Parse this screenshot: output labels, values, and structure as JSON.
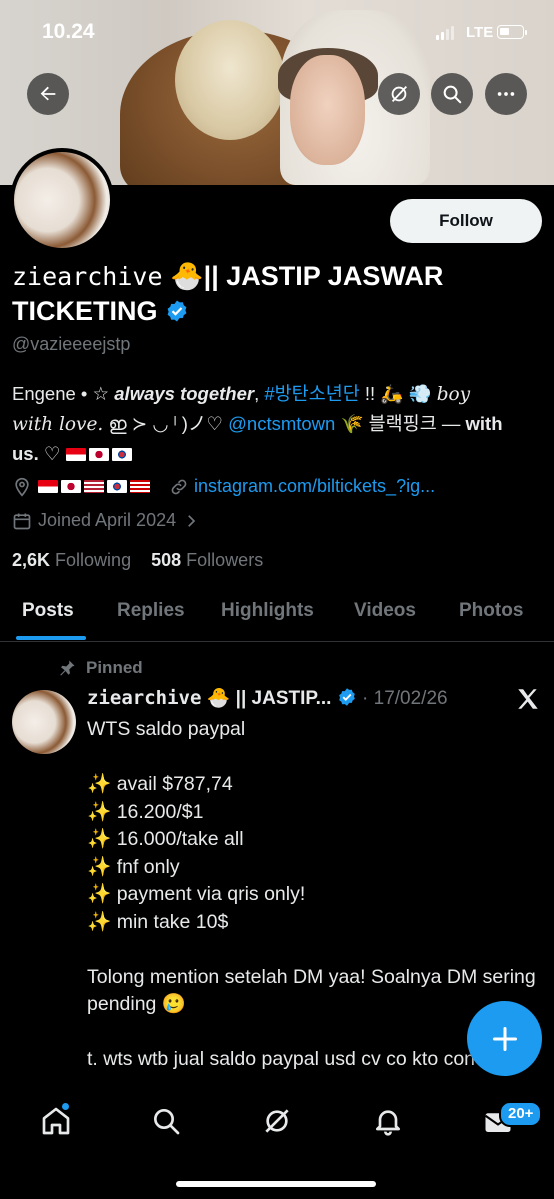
{
  "status_bar": {
    "time": "10.24",
    "network": "LTE"
  },
  "profile": {
    "display_name_part1": "ziearchive",
    "display_name_emoji": "🐣",
    "display_name_part2": "|| JASTIP JASWAR TICKETING",
    "handle": "@vazieeeejstp",
    "follow_label": "Follow",
    "bio": {
      "l1_a": "Engene • ☆ ",
      "l1_b": "always together",
      "l1_c": ", ",
      "l1_tag": "#방탄소년단",
      "l1_d": " !! 🛵 💨 ",
      "l1_e": "boy",
      "l2_a": "with love.",
      "l2_b": " ഇ ≻ ◡ ˡ )ノ♡ ",
      "l2_mention": "@nctsmtown",
      "l2_c": " 🌾 블랙핑크 — ",
      "l2_d": "with",
      "l3_a": "us.",
      "l3_b": " ♡ "
    },
    "location_flags": [
      "id",
      "jp",
      "us",
      "kr",
      "my"
    ],
    "bio_flags": [
      "id",
      "jp",
      "kr"
    ],
    "website": "instagram.com/biltickets_?ig...",
    "joined": "Joined April 2024",
    "following_count": "2,6K",
    "following_label": "Following",
    "followers_count": "508",
    "followers_label": "Followers"
  },
  "tabs": [
    "Posts",
    "Replies",
    "Highlights",
    "Videos",
    "Photos"
  ],
  "active_tab": "Posts",
  "pinned_tweet": {
    "pinned_label": "Pinned",
    "author_name": "ziearchive",
    "author_emoji": "🐣",
    "author_rest": "|| JASTIP...",
    "date": "17/02/26",
    "separator": "·",
    "body": "WTS saldo paypal\n\n✨ avail $787,74\n✨ 16.200/$1\n✨ 16.000/take all\n✨ fnf only\n✨ payment via qris only!\n✨ min take 10$\n\nTolong mention setelah DM yaa! Soalnya DM sering pending 🥲\n\nt. wts wtb jual saldo paypal usd cv co kto convert"
  },
  "bottom_nav": {
    "messages_badge": "20+"
  },
  "colors": {
    "accent": "#1d9bf0",
    "background": "#000000",
    "muted": "#71767b"
  }
}
